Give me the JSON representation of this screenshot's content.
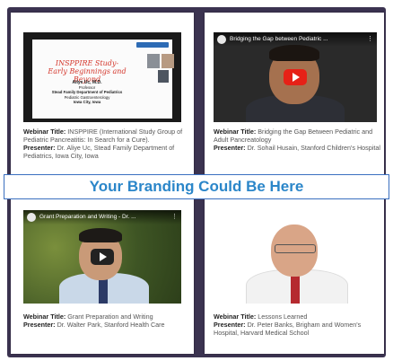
{
  "banner": {
    "text": "Your Branding Could Be Here"
  },
  "webinars": [
    {
      "title_label": "Webinar Title:",
      "title": "INSPPIRE (International Study Group of Pediatric Pancreatitis: In Search for a Cure).",
      "presenter_label": "Presenter:",
      "presenter": "Dr. Aliye Uc, Stead Family Department of Pediatrics, Iowa City, Iowa",
      "slide": {
        "title": "INSPPIRE Study-\nEarly Beginnings and Beyond",
        "lines": [
          "Aliye Uc, M.D.",
          "Professor",
          "Stead Family Department of Pediatrics",
          "Pediatric Gastroenterology",
          "Iowa City, Iowa"
        ]
      }
    },
    {
      "title_label": "Webinar Title:",
      "title": "Bridging the Gap Between Pediatric and Adult Pancreatology",
      "presenter_label": "Presenter:",
      "presenter": "Dr. Sohail Husain, Stanford Children's Hospital",
      "video_title": "Bridging the Gap between Pediatric ..."
    },
    {
      "title_label": "Webinar Title:",
      "title": "Grant Preparation and Writing",
      "presenter_label": "Presenter:",
      "presenter": "Dr. Walter Park, Stanford Health Care",
      "video_title": "Grant Preparation and Writing - Dr. ..."
    },
    {
      "title_label": "Webinar Title:",
      "title": "Lessons Learned",
      "presenter_label": "Presenter:",
      "presenter": "Dr. Peter Banks, Brigham and Women's Hospital, Harvard Medical School"
    }
  ],
  "icons": {
    "play": "play-icon",
    "menu": "more-vert-icon",
    "channel": "channel-avatar-icon"
  },
  "colors": {
    "frame": "#3b3350",
    "banner_text": "#2b86c9",
    "play_button": "#e62117"
  }
}
